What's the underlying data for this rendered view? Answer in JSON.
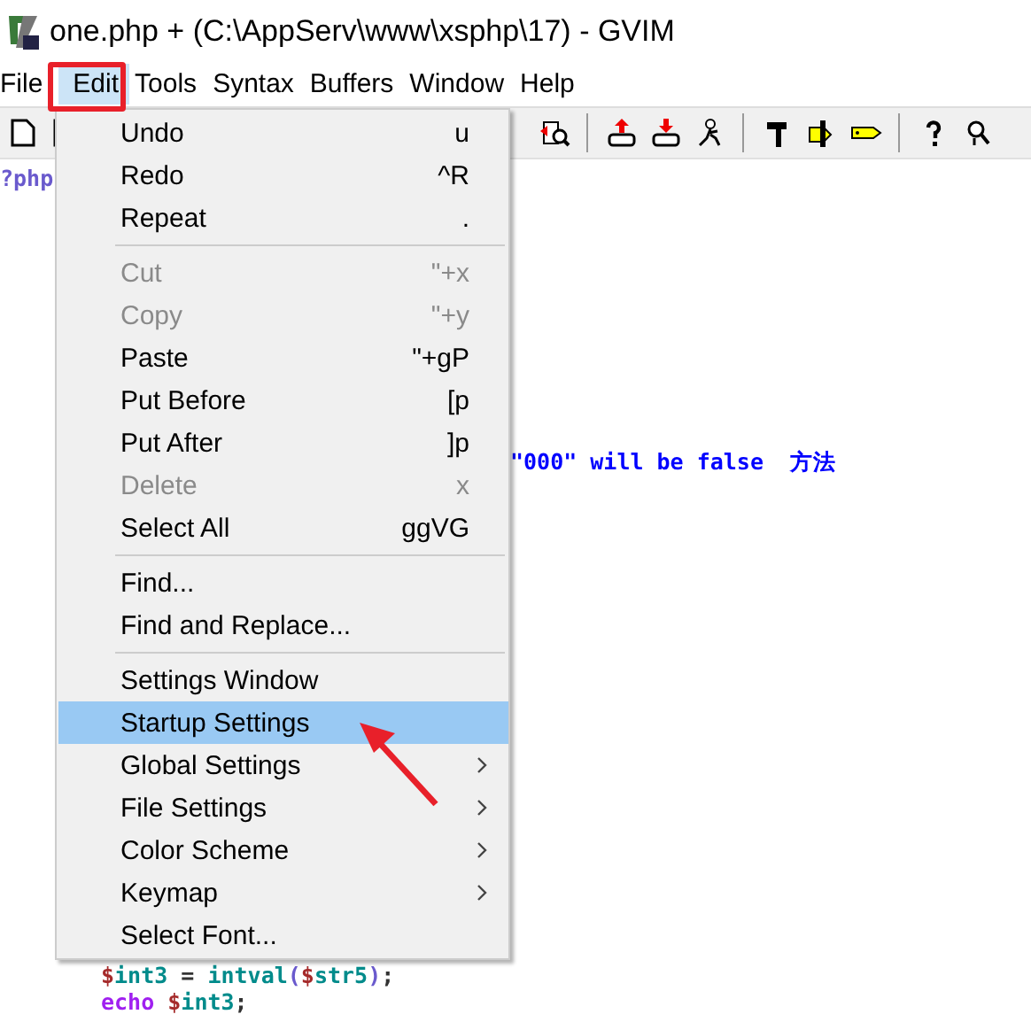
{
  "window": {
    "title": "one.php + (C:\\AppServ\\www\\xsphp\\17) - GVIM"
  },
  "menubar": [
    {
      "label": "File",
      "selected": false
    },
    {
      "label": "Edit",
      "selected": true
    },
    {
      "label": "Tools",
      "selected": false
    },
    {
      "label": "Syntax",
      "selected": false
    },
    {
      "label": "Buffers",
      "selected": false
    },
    {
      "label": "Window",
      "selected": false
    },
    {
      "label": "Help",
      "selected": false
    }
  ],
  "editor": {
    "lines": [
      {
        "tokens": [
          {
            "text": "?php",
            "kind": "tag"
          }
        ]
      },
      {
        "tokens": [
          {
            "text": "\"000\" will be false  方法",
            "kind": "comment"
          }
        ]
      },
      {
        "tokens": [
          {
            "text": "$",
            "kind": "sigil"
          },
          {
            "text": "int3 ",
            "kind": "ident"
          },
          {
            "text": "=",
            "kind": "op"
          },
          {
            "text": " intval",
            "kind": "ident"
          },
          {
            "text": "(",
            "kind": "paren"
          },
          {
            "text": "$",
            "kind": "sigil"
          },
          {
            "text": "str5",
            "kind": "ident"
          },
          {
            "text": ")",
            "kind": "paren"
          },
          {
            "text": ";",
            "kind": "op"
          }
        ]
      },
      {
        "tokens": [
          {
            "text": "echo ",
            "kind": "keyword"
          },
          {
            "text": "$",
            "kind": "sigil"
          },
          {
            "text": "int3",
            "kind": "ident"
          },
          {
            "text": ";",
            "kind": "op"
          }
        ]
      }
    ]
  },
  "edit_menu": [
    {
      "kind": "item",
      "label": "Undo",
      "shortcut": "u",
      "disabled": false,
      "selected": false,
      "submenu": false
    },
    {
      "kind": "item",
      "label": "Redo",
      "shortcut": "^R",
      "disabled": false,
      "selected": false,
      "submenu": false
    },
    {
      "kind": "item",
      "label": "Repeat",
      "shortcut": ".",
      "disabled": false,
      "selected": false,
      "submenu": false
    },
    {
      "kind": "separator"
    },
    {
      "kind": "item",
      "label": "Cut",
      "shortcut": "\"+x",
      "disabled": true,
      "selected": false,
      "submenu": false
    },
    {
      "kind": "item",
      "label": "Copy",
      "shortcut": "\"+y",
      "disabled": true,
      "selected": false,
      "submenu": false
    },
    {
      "kind": "item",
      "label": "Paste",
      "shortcut": "\"+gP",
      "disabled": false,
      "selected": false,
      "submenu": false
    },
    {
      "kind": "item",
      "label": "Put Before",
      "shortcut": "[p",
      "disabled": false,
      "selected": false,
      "submenu": false
    },
    {
      "kind": "item",
      "label": "Put After",
      "shortcut": "]p",
      "disabled": false,
      "selected": false,
      "submenu": false
    },
    {
      "kind": "item",
      "label": "Delete",
      "shortcut": "x",
      "disabled": true,
      "selected": false,
      "submenu": false
    },
    {
      "kind": "item",
      "label": "Select All",
      "shortcut": "ggVG",
      "disabled": false,
      "selected": false,
      "submenu": false
    },
    {
      "kind": "separator"
    },
    {
      "kind": "item",
      "label": "Find...",
      "disabled": false,
      "selected": false,
      "submenu": false
    },
    {
      "kind": "item",
      "label": "Find and Replace...",
      "disabled": false,
      "selected": false,
      "submenu": false
    },
    {
      "kind": "separator"
    },
    {
      "kind": "item",
      "label": "Settings Window",
      "disabled": false,
      "selected": false,
      "submenu": false
    },
    {
      "kind": "item",
      "label": "Startup Settings",
      "disabled": false,
      "selected": true,
      "submenu": false
    },
    {
      "kind": "item",
      "label": "Global Settings",
      "disabled": false,
      "selected": false,
      "submenu": true
    },
    {
      "kind": "item",
      "label": "File Settings",
      "disabled": false,
      "selected": false,
      "submenu": true
    },
    {
      "kind": "item",
      "label": "Color Scheme",
      "disabled": false,
      "selected": false,
      "submenu": true
    },
    {
      "kind": "item",
      "label": "Keymap",
      "disabled": false,
      "selected": false,
      "submenu": true
    },
    {
      "kind": "item",
      "label": "Select Font...",
      "disabled": false,
      "selected": false,
      "submenu": false
    }
  ]
}
